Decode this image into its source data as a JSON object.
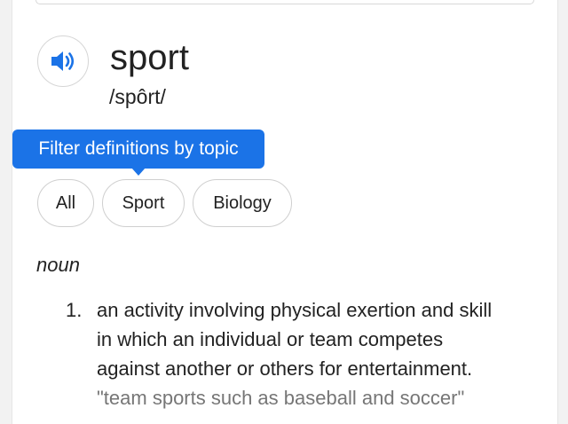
{
  "entry": {
    "word": "sport",
    "pronunciation": "/spôrt/",
    "speaker_icon": "speaker-volume-icon"
  },
  "filter": {
    "tooltip": "Filter definitions by topic",
    "chips": [
      "All",
      "Sport",
      "Biology"
    ]
  },
  "definition": {
    "part_of_speech": "noun",
    "number": "1.",
    "lines": [
      "an activity involving physical exertion and skill",
      "in which an individual or team competes",
      "against another or others for entertainment."
    ],
    "example": "\"team sports such as baseball and soccer\""
  },
  "colors": {
    "accent": "#1b73e7",
    "text": "#222222",
    "example_text": "#767676"
  }
}
